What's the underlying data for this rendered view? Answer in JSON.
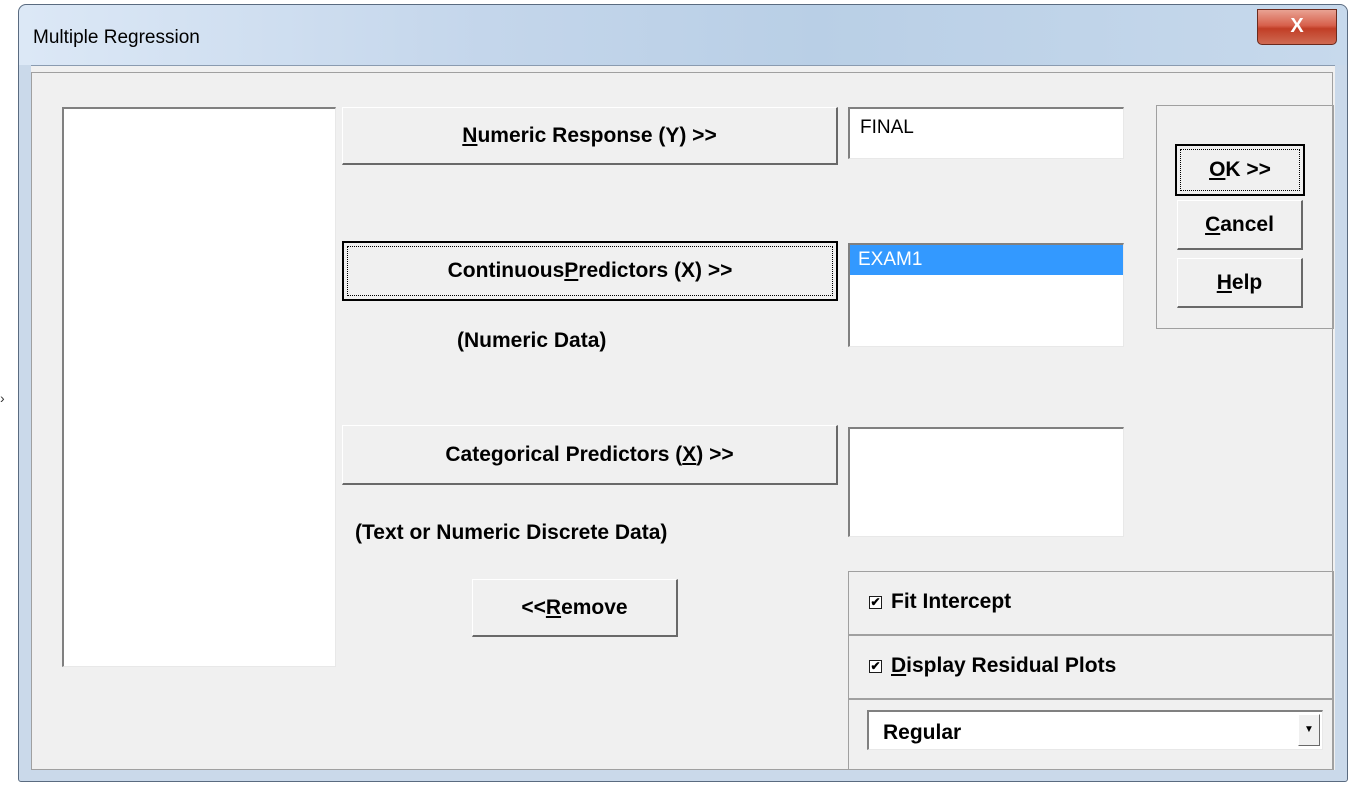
{
  "window": {
    "title": "Multiple Regression",
    "close_glyph": "X"
  },
  "variables_list": {
    "items": []
  },
  "numeric_response": {
    "button_label_prefix": "",
    "button_label_mnemonic": "N",
    "button_label_rest": "umeric Response (Y) >>",
    "field_value": "FINAL"
  },
  "continuous_predictors": {
    "button_label_prefix": "Continuous ",
    "button_label_mnemonic": "P",
    "button_label_rest": "redictors (X) >>",
    "hint": "(Numeric Data)",
    "list_items": [
      "EXAM1"
    ]
  },
  "categorical_predictors": {
    "button_label_prefix": "Categorical Predictors (",
    "button_label_mnemonic": "X",
    "button_label_rest": ") >>",
    "hint": "(Text or Numeric Discrete Data)",
    "list_items": []
  },
  "remove_button": {
    "label_prefix": "<< ",
    "label_mnemonic": "R",
    "label_rest": "emove"
  },
  "actions": {
    "ok_mnemonic": "O",
    "ok_rest": "K >>",
    "cancel_mnemonic": "C",
    "cancel_rest": "ancel",
    "help_mnemonic": "H",
    "help_rest": "elp"
  },
  "options": {
    "fit_intercept_label": "Fit Intercept",
    "fit_intercept_checked": true,
    "residual_plots_mnemonic": "D",
    "residual_plots_rest": "isplay Residual Plots",
    "residual_plots_checked": true,
    "residual_type_selected": "Regular",
    "check_glyph": "✔",
    "dropdown_glyph": "▼"
  }
}
